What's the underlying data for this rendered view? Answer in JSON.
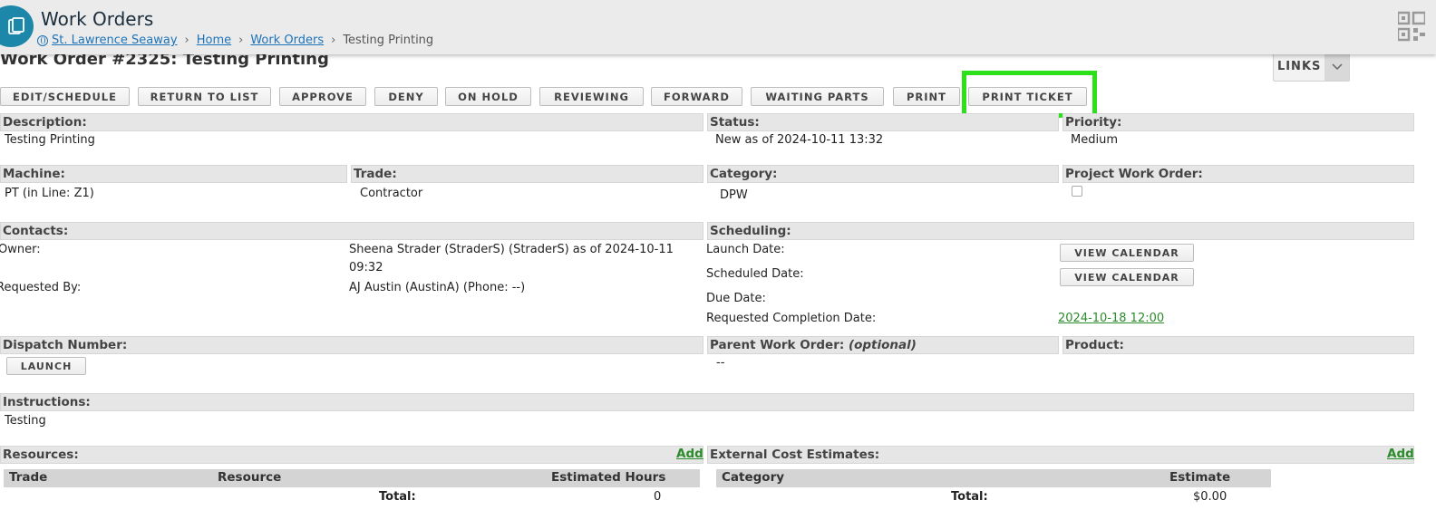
{
  "header": {
    "app_title": "Work Orders",
    "breadcrumb": [
      "St. Lawrence Seaway",
      "Home",
      "Work Orders",
      "Testing Printing"
    ],
    "app_icon": "clipboard-icon",
    "qr_icon": "qr-code-icon"
  },
  "page": {
    "title": "Work Order #2325: Testing Printing",
    "links_label": "LINKS"
  },
  "toolbar": {
    "buttons": [
      "EDIT/SCHEDULE",
      "RETURN TO LIST",
      "APPROVE",
      "DENY",
      "ON HOLD",
      "REVIEWING",
      "FORWARD",
      "WAITING PARTS",
      "PRINT",
      "PRINT TICKET"
    ],
    "highlight_color": "#2de01a"
  },
  "fields": {
    "description_label": "Description:",
    "description_value": "Testing Printing",
    "status_label": "Status:",
    "status_value": "New as of 2024-10-11 13:32",
    "priority_label": "Priority:",
    "priority_value": "Medium",
    "machine_label": "Machine:",
    "machine_value": "PT (in Line: Z1)",
    "trade_label": "Trade:",
    "trade_value": "Contractor",
    "category_label": "Category:",
    "category_value": "DPW",
    "project_label": "Project Work Order:",
    "contacts_label": "Contacts:",
    "owner_label": "Owner:",
    "owner_value_line1": "Sheena Strader (StraderS) (StraderS) as of 2024-10-11",
    "owner_value_line2": "09:32",
    "requested_by_label": "Requested By:",
    "requested_by_value": "AJ Austin (AustinA) (Phone: --)",
    "scheduling_label": "Scheduling:",
    "launch_date_label": "Launch Date:",
    "scheduled_date_label": "Scheduled Date:",
    "due_date_label": "Due Date:",
    "requested_completion_label": "Requested Completion Date:",
    "requested_completion_value": "2024-10-18 12:00",
    "view_calendar": "VIEW CALENDAR",
    "dispatch_label": "Dispatch Number:",
    "launch_button": "LAUNCH",
    "parent_label": "Parent Work Order: ",
    "parent_optional": "(optional)",
    "parent_value": "--",
    "product_label": "Product:",
    "instructions_label": "Instructions:",
    "instructions_value": "Testing"
  },
  "resources": {
    "label": "Resources:",
    "add": "Add",
    "columns": [
      "Trade",
      "Resource",
      "Estimated Hours"
    ],
    "total_label": "Total:",
    "total_value": "0"
  },
  "external": {
    "label": "External Cost Estimates:",
    "add": "Add",
    "columns": [
      "Category",
      "Estimate"
    ],
    "total_label": "Total:",
    "total_value": "$0.00"
  }
}
